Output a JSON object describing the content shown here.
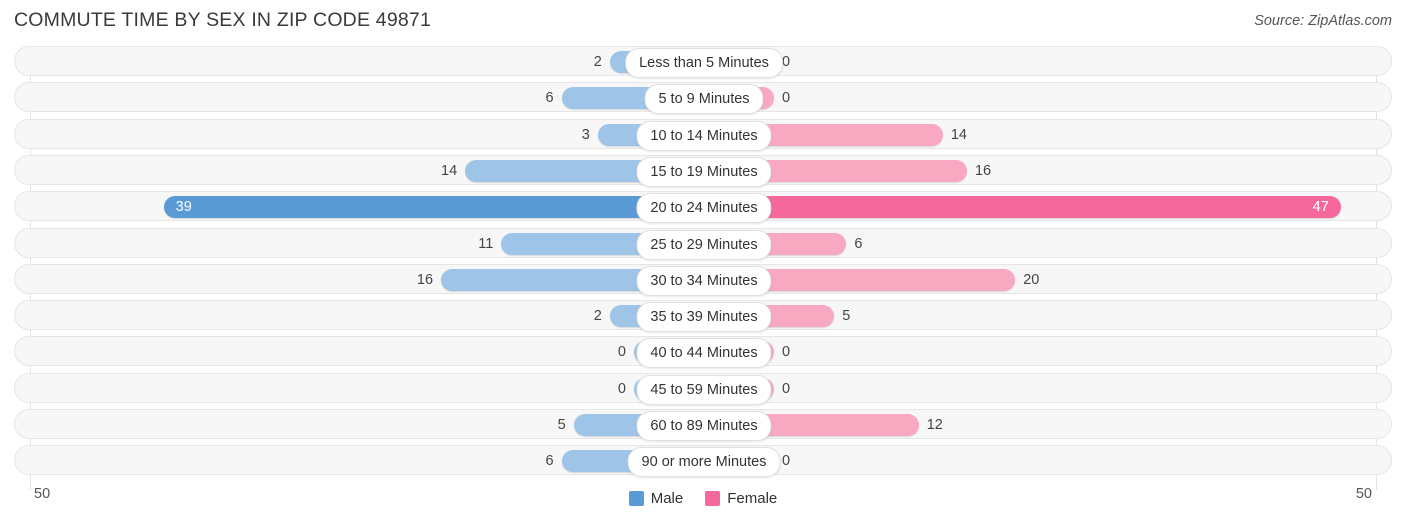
{
  "header": {
    "title": "COMMUTE TIME BY SEX IN ZIP CODE 49871",
    "source": "Source: ZipAtlas.com"
  },
  "axis": {
    "left_max": "50",
    "right_max": "50"
  },
  "legend": {
    "items": [
      {
        "label": "Male",
        "color": "#5b9bd5"
      },
      {
        "label": "Female",
        "color": "#f4689c"
      }
    ]
  },
  "colors": {
    "male_light": "#9ec5e8",
    "male_dark": "#5b9bd5",
    "female_light": "#f9a8c2",
    "female_dark": "#f4689c",
    "track": "#f7f7f7",
    "track_border": "#e6e6e6"
  },
  "chart_data": {
    "type": "bar",
    "title": "COMMUTE TIME BY SEX IN ZIP CODE 49871",
    "subtitle": "Source: ZipAtlas.com",
    "orientation": "horizontal-diverging",
    "xlabel": "",
    "ylabel": "",
    "xlim": [
      50,
      50
    ],
    "axis_tick_labels": [
      "50",
      "50"
    ],
    "grid": true,
    "legend_position": "bottom-center",
    "categories": [
      "Less than 5 Minutes",
      "5 to 9 Minutes",
      "10 to 14 Minutes",
      "15 to 19 Minutes",
      "20 to 24 Minutes",
      "25 to 29 Minutes",
      "30 to 34 Minutes",
      "35 to 39 Minutes",
      "40 to 44 Minutes",
      "45 to 59 Minutes",
      "60 to 89 Minutes",
      "90 or more Minutes"
    ],
    "series": [
      {
        "name": "Male",
        "color": "#5b9bd5",
        "values": [
          2,
          6,
          3,
          14,
          39,
          11,
          16,
          2,
          0,
          0,
          5,
          6
        ]
      },
      {
        "name": "Female",
        "color": "#f4689c",
        "values": [
          0,
          0,
          14,
          16,
          47,
          6,
          20,
          5,
          0,
          0,
          12,
          0
        ]
      }
    ],
    "highlighted_category": "20 to 24 Minutes",
    "max_value": 47
  },
  "rows": [
    {
      "category": "Less than 5 Minutes",
      "male": "2",
      "female": "0",
      "male_v": 2,
      "female_v": 0,
      "highlight": false
    },
    {
      "category": "5 to 9 Minutes",
      "male": "6",
      "female": "0",
      "male_v": 6,
      "female_v": 0,
      "highlight": false
    },
    {
      "category": "10 to 14 Minutes",
      "male": "3",
      "female": "14",
      "male_v": 3,
      "female_v": 14,
      "highlight": false
    },
    {
      "category": "15 to 19 Minutes",
      "male": "14",
      "female": "16",
      "male_v": 14,
      "female_v": 16,
      "highlight": false
    },
    {
      "category": "20 to 24 Minutes",
      "male": "39",
      "female": "47",
      "male_v": 39,
      "female_v": 47,
      "highlight": true
    },
    {
      "category": "25 to 29 Minutes",
      "male": "11",
      "female": "6",
      "male_v": 11,
      "female_v": 6,
      "highlight": false
    },
    {
      "category": "30 to 34 Minutes",
      "male": "16",
      "female": "20",
      "male_v": 16,
      "female_v": 20,
      "highlight": false
    },
    {
      "category": "35 to 39 Minutes",
      "male": "2",
      "female": "5",
      "male_v": 2,
      "female_v": 5,
      "highlight": false
    },
    {
      "category": "40 to 44 Minutes",
      "male": "0",
      "female": "0",
      "male_v": 0,
      "female_v": 0,
      "highlight": false
    },
    {
      "category": "45 to 59 Minutes",
      "male": "0",
      "female": "0",
      "male_v": 0,
      "female_v": 0,
      "highlight": false
    },
    {
      "category": "60 to 89 Minutes",
      "male": "5",
      "female": "12",
      "male_v": 5,
      "female_v": 12,
      "highlight": false
    },
    {
      "category": "90 or more Minutes",
      "male": "6",
      "female": "0",
      "male_v": 6,
      "female_v": 0,
      "highlight": false
    }
  ]
}
